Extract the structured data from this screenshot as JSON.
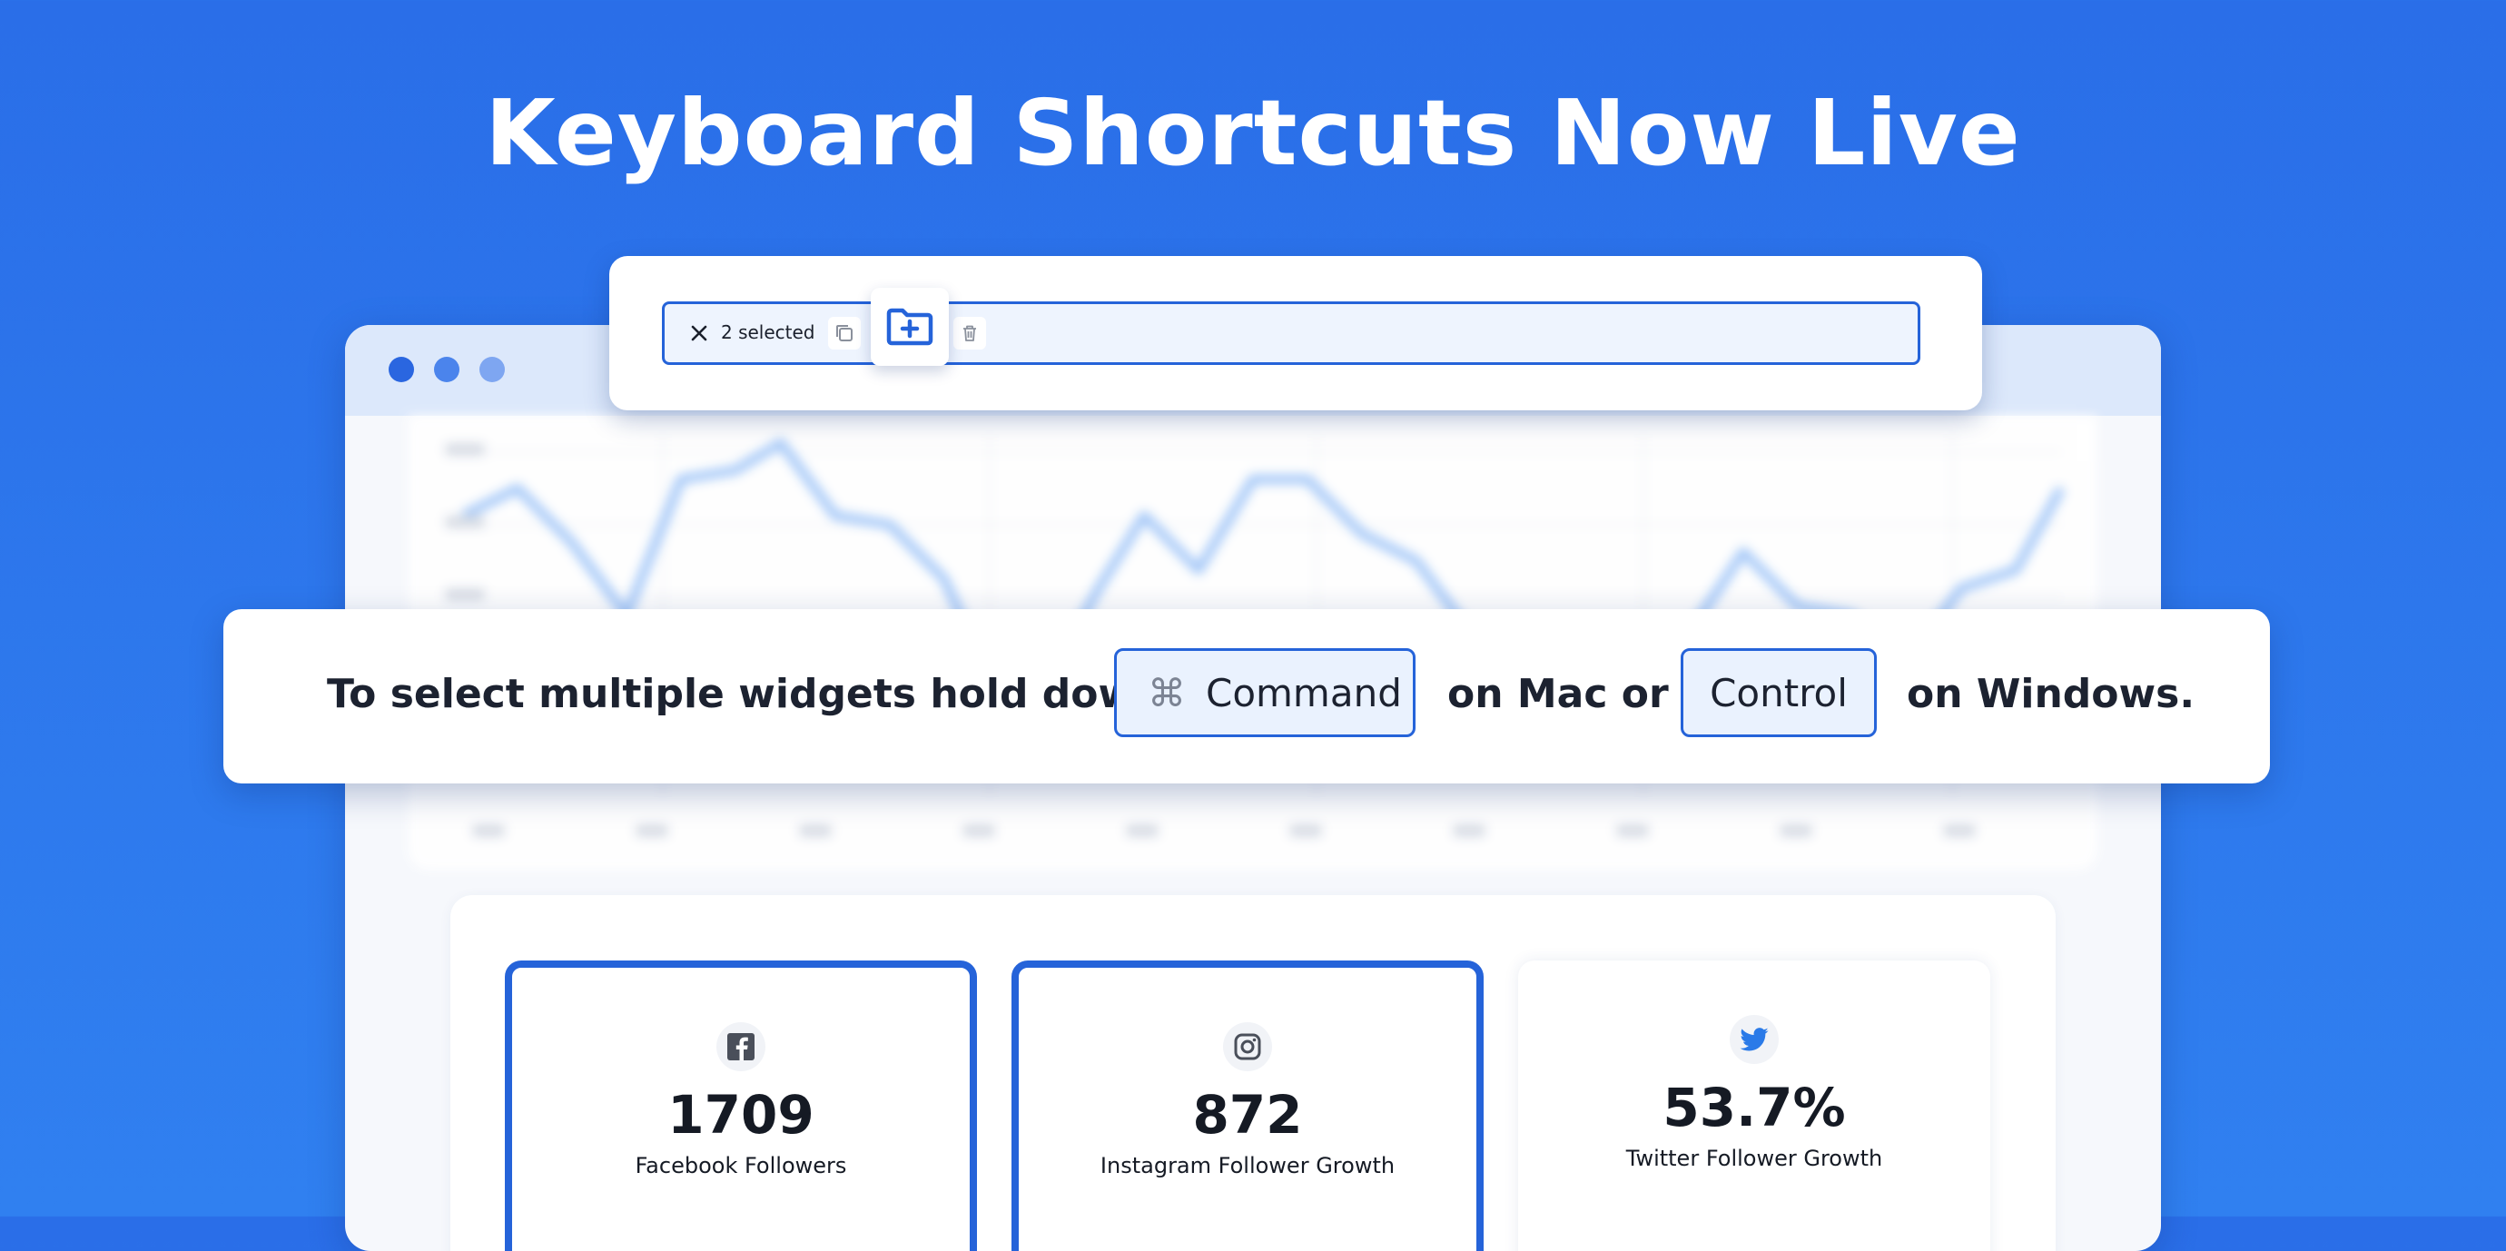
{
  "headline": "Keyboard Shortcuts Now Live",
  "toolbar": {
    "selected_label": "2 selected",
    "close_icon": "close-icon",
    "copy_icon": "copy-icon",
    "add_folder_icon": "folder-plus-icon",
    "delete_icon": "trash-icon"
  },
  "banner": {
    "text_before": "To select multiple widgets hold down",
    "key_mac_glyph": "⌘",
    "key_mac": "Command",
    "text_middle": "on Mac or",
    "key_windows": "Control",
    "text_after": "on Windows."
  },
  "stats": [
    {
      "icon": "facebook-icon",
      "value": "1709",
      "label": "Facebook Followers",
      "selected": true
    },
    {
      "icon": "instagram-icon",
      "value": "872",
      "label": "Instagram Follower Growth",
      "selected": true
    },
    {
      "icon": "twitter-icon",
      "value": "53.7%",
      "label": "Twitter Follower Growth",
      "selected": false
    }
  ],
  "colors": {
    "background": "#2a6ee8",
    "accent": "#2563d9",
    "key_fill": "#eaf2fe",
    "chart_line": "#9cc3f7"
  }
}
